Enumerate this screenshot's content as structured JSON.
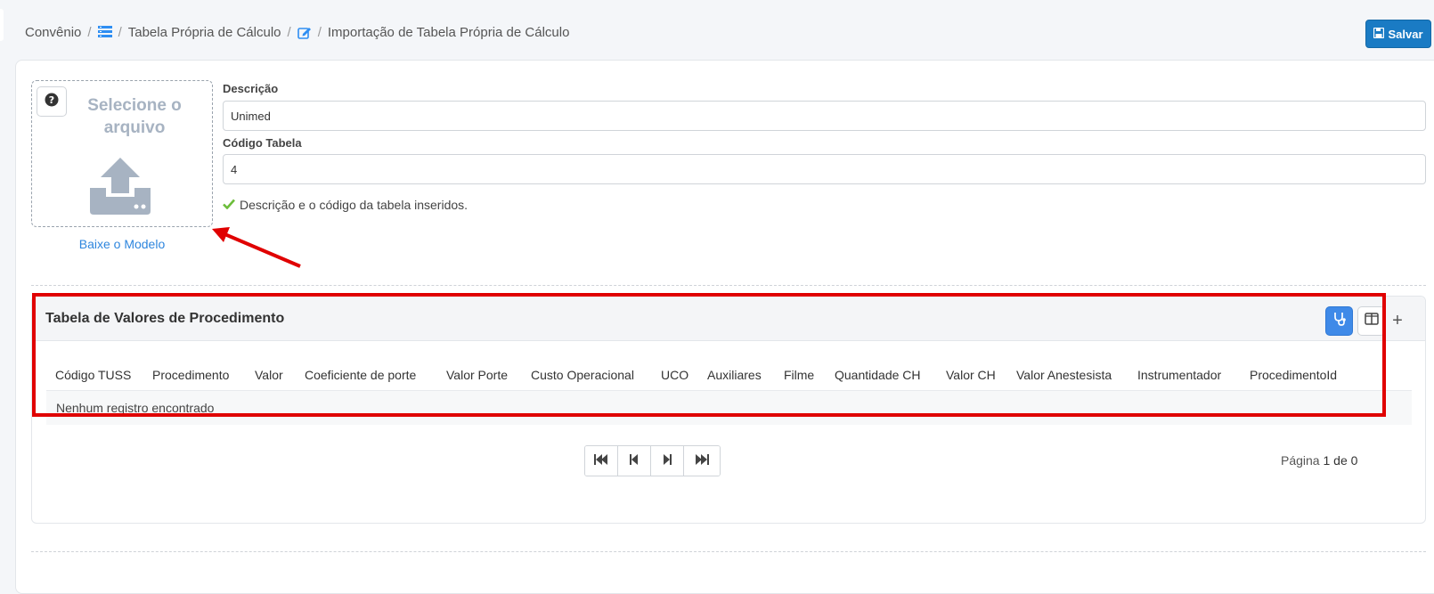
{
  "breadcrumb": {
    "items": [
      "Convênio",
      "Tabela Própria de Cálculo",
      "Importação de Tabela Própria de Cálculo"
    ],
    "separator": "/"
  },
  "toolbar": {
    "save_label": "Salvar"
  },
  "upload": {
    "title": "Selecione o arquivo",
    "model_link": "Baixe o Modelo"
  },
  "form": {
    "descricao_label": "Descrição",
    "descricao_value": "Unimed",
    "codigo_label": "Código Tabela",
    "codigo_value": "4",
    "validation_msg": "Descrição e o código da tabela inseridos."
  },
  "grid": {
    "title": "Tabela de Valores de Procedimento",
    "plus_label": "+",
    "columns": [
      "Código TUSS",
      "Procedimento",
      "Valor",
      "Coeficiente de porte",
      "Valor Porte",
      "Custo Operacional",
      "UCO",
      "Auxiliares",
      "Filme",
      "Quantidade CH",
      "Valor CH",
      "Valor Anestesista",
      "Instrumentador",
      "ProcedimentoId"
    ],
    "empty_text": "Nenhum registro encontrado"
  },
  "pagination": {
    "prefix": "Página",
    "current": "1",
    "middle": "de",
    "total": "0"
  },
  "colors": {
    "primary": "#1a7bc4",
    "link": "#2e86de",
    "success": "#6cbd3a",
    "annotation": "#e00000"
  }
}
